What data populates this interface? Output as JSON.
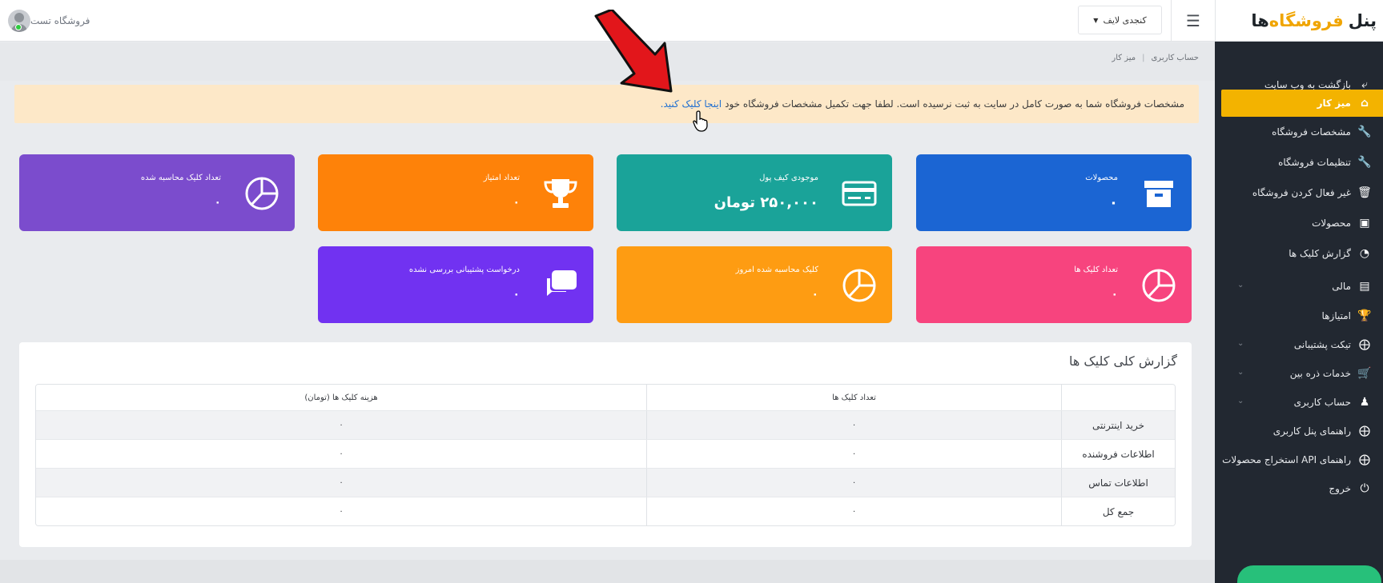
{
  "topbar": {
    "brand_part1": "پنل",
    "brand_part2": "فروشگاه",
    "brand_part3": "ها",
    "menu_icon": "hamburger-icon",
    "shop_select_value": "کنجدی لایف",
    "user_name": "فروشگاه تست"
  },
  "sidebar": {
    "items": [
      {
        "label": "بازگشت به وب سایت",
        "icon": "reply-icon"
      },
      {
        "label": "میز کار",
        "icon": "home-icon",
        "active": true
      },
      {
        "label": "مشخصات فروشگاه",
        "icon": "wrench-icon"
      },
      {
        "label": "تنظیمات فروشگاه",
        "icon": "wrench-icon"
      },
      {
        "label": "غیر فعال کردن فروشگاه",
        "icon": "trash-icon"
      },
      {
        "label": "محصولات",
        "icon": "archive-icon"
      },
      {
        "label": "گزارش کلیک ها",
        "icon": "pie-chart-icon"
      },
      {
        "label": "مالی",
        "icon": "credit-card-icon",
        "expandable": true
      },
      {
        "label": "امتیازها",
        "icon": "trophy-icon"
      },
      {
        "label": "تیکت پشتیبانی",
        "icon": "lifebuoy-icon",
        "expandable": true
      },
      {
        "label": "خدمات ذره بین",
        "icon": "cart-icon",
        "expandable": true
      },
      {
        "label": "حساب کاربری",
        "icon": "user-icon",
        "expandable": true
      },
      {
        "label": "راهنمای پنل کاربری",
        "icon": "lifebuoy-icon"
      },
      {
        "label": "راهنمای API استخراج محصولات",
        "icon": "lifebuoy-icon"
      },
      {
        "label": "خروج",
        "icon": "power-icon"
      }
    ]
  },
  "breadcrumb": {
    "items": [
      "حساب کاربری",
      "میز کار"
    ],
    "separator": "|"
  },
  "alert": {
    "text": "مشخصات فروشگاه شما به صورت کامل در سایت به ثبت نرسیده است. لطفا جهت تکمیل مشخصات فروشگاه خود",
    "link": "اینجا کلیک کنید."
  },
  "cards": {
    "products": {
      "label": "محصولات",
      "value": "۰",
      "color": "#1b65d3",
      "icon": "archive-icon"
    },
    "wallet": {
      "label": "موجودی کیف پول",
      "value": "۲۵۰,۰۰۰ تومان",
      "color": "#1aa399",
      "icon": "credit-card-icon"
    },
    "points": {
      "label": "تعداد امتیاز",
      "value": "۰",
      "color": "#fe8209",
      "icon": "trophy-icon"
    },
    "calculated_clicks": {
      "label": "تعداد کلیک محاسبه شده",
      "value": "۰",
      "color": "#7b4ccd",
      "icon": "pie-chart-icon"
    },
    "clicks": {
      "label": "تعداد کلیک ها",
      "value": "۰",
      "color": "#f7447e",
      "icon": "pie-chart-icon"
    },
    "today_clicks": {
      "label": "کلیک محاسبه شده امروز",
      "value": "۰",
      "color": "#fe9c12",
      "icon": "pie-chart-icon"
    },
    "support": {
      "label": "درخواست پشتیبانی بررسی نشده",
      "value": "۰",
      "color": "#7132f1",
      "icon": "chat-icon"
    }
  },
  "report": {
    "title": "گزارش کلی کلیک ها",
    "columns": [
      "",
      "تعداد کلیک ها",
      "هزینه کلیک ها (تومان)"
    ],
    "rows": [
      {
        "label": "خرید اینترنتی",
        "clicks": "۰",
        "cost": "۰"
      },
      {
        "label": "اطلاعات فروشنده",
        "clicks": "۰",
        "cost": "۰"
      },
      {
        "label": "اطلاعات تماس",
        "clicks": "۰",
        "cost": "۰"
      },
      {
        "label": "جمع کل",
        "clicks": "۰",
        "cost": "۰"
      }
    ]
  },
  "colors": {
    "sidebar_bg": "#222831",
    "active_item": "#f3b300",
    "brand_accent": "#f0a500",
    "alert_bg": "#fde8c8",
    "arrow": "#e2161b"
  }
}
